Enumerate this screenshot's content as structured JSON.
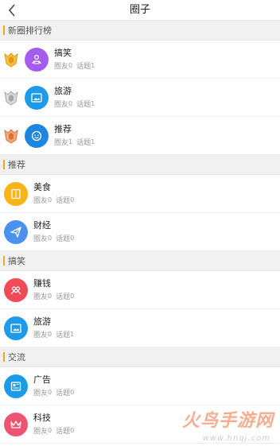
{
  "header": {
    "title": "圈子"
  },
  "sections": [
    {
      "label": "新圈排行榜",
      "items": [
        {
          "name": "搞笑",
          "friends_label": "圈友",
          "friends": "0",
          "topics_label": "话题",
          "topics": "1",
          "medal": "gold",
          "icon": "people-icon",
          "color": "#a45cf0"
        },
        {
          "name": "旅游",
          "friends_label": "圈友",
          "friends": "0",
          "topics_label": "话题",
          "topics": "1",
          "medal": "silver",
          "icon": "photo-icon",
          "color": "#1e9be8"
        },
        {
          "name": "推荐",
          "friends_label": "圈友",
          "friends": "1",
          "topics_label": "话题",
          "topics": "1",
          "medal": "bronze",
          "icon": "smile-icon",
          "color": "#1e86e0"
        }
      ]
    },
    {
      "label": "推荐",
      "items": [
        {
          "name": "美食",
          "friends_label": "圈友",
          "friends": "0",
          "topics_label": "话题",
          "topics": "0",
          "icon": "book-icon",
          "color": "#f6b417"
        },
        {
          "name": "财经",
          "friends_label": "圈友",
          "friends": "0",
          "topics_label": "话题",
          "topics": "0",
          "icon": "send-icon",
          "color": "#4a92ee"
        }
      ]
    },
    {
      "label": "搞笑",
      "items": [
        {
          "name": "赚钱",
          "friends_label": "圈友",
          "friends": "0",
          "topics_label": "话题",
          "topics": "0",
          "icon": "group-icon",
          "color": "#ef4a55"
        },
        {
          "name": "旅游",
          "friends_label": "圈友",
          "friends": "0",
          "topics_label": "话题",
          "topics": "1",
          "icon": "photo-icon",
          "color": "#1e9be8"
        }
      ]
    },
    {
      "label": "交流",
      "items": [
        {
          "name": "广告",
          "friends_label": "圈友",
          "friends": "0",
          "topics_label": "话题",
          "topics": "0",
          "icon": "newspaper-icon",
          "color": "#1e9be8"
        },
        {
          "name": "科技",
          "friends_label": "圈友",
          "friends": "0",
          "topics_label": "话题",
          "topics": "0",
          "icon": "crown-icon",
          "color": "#ee5472"
        }
      ]
    }
  ],
  "watermark": {
    "main": "火鸟手游网",
    "url": "www.hnqj.com"
  }
}
